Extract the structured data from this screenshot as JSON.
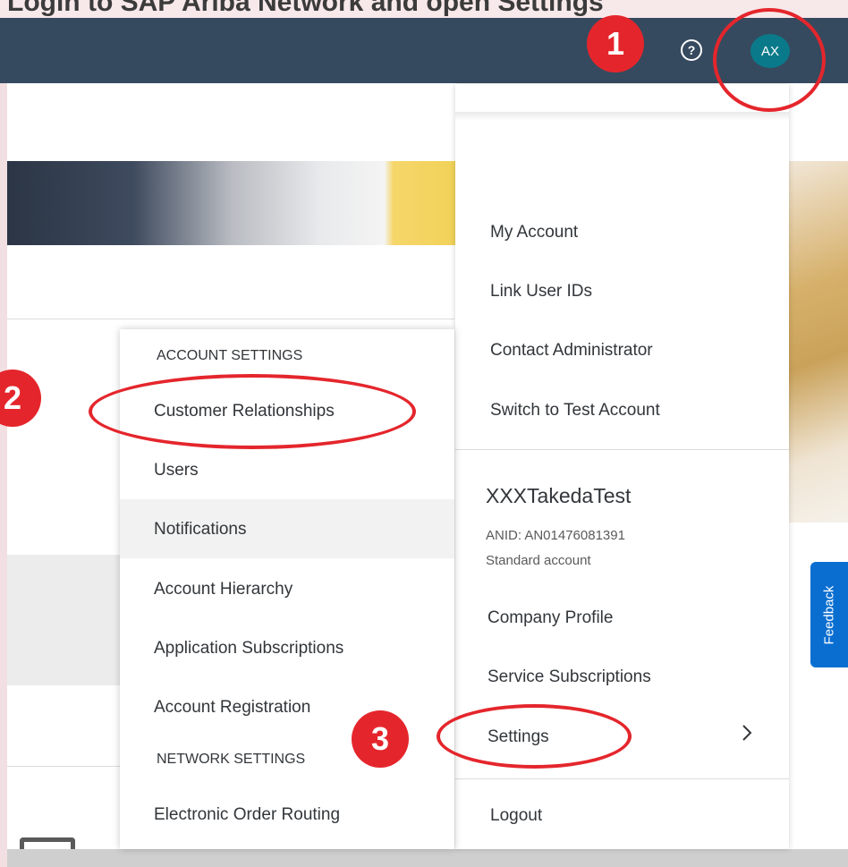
{
  "page": {
    "title": "Login to SAP Ariba Network and open Settings"
  },
  "header": {
    "help_icon": "question-circle-icon",
    "help_glyph": "?",
    "avatar_initials": "AX",
    "avatar_color": "#0a7a8a",
    "bar_color": "#354a5f"
  },
  "user_menu": {
    "items": [
      {
        "label": "My Account"
      },
      {
        "label": "Link User IDs"
      },
      {
        "label": "Contact Administrator"
      },
      {
        "label": "Switch to Test Account"
      }
    ],
    "company": {
      "name": "XXXTakedaTest",
      "anid": "ANID: AN01476081391",
      "type": "Standard account"
    },
    "company_items": [
      {
        "label": "Company Profile"
      },
      {
        "label": "Service Subscriptions"
      },
      {
        "label": "Settings",
        "icon": "chevron-right-icon"
      }
    ],
    "logout_label": "Logout"
  },
  "settings_submenu": {
    "account_header": "ACCOUNT SETTINGS",
    "account_items": [
      {
        "label": "Customer Relationships"
      },
      {
        "label": "Users"
      },
      {
        "label": "Notifications"
      },
      {
        "label": "Account Hierarchy"
      },
      {
        "label": "Application Subscriptions"
      },
      {
        "label": "Account Registration"
      }
    ],
    "network_header": "NETWORK SETTINGS",
    "network_items": [
      {
        "label": "Electronic Order Routing"
      }
    ]
  },
  "feedback_label": "Feedback",
  "annotations": {
    "step_1": "1",
    "step_2": "2",
    "step_3": "3",
    "highlight_color": "#e4262c"
  }
}
